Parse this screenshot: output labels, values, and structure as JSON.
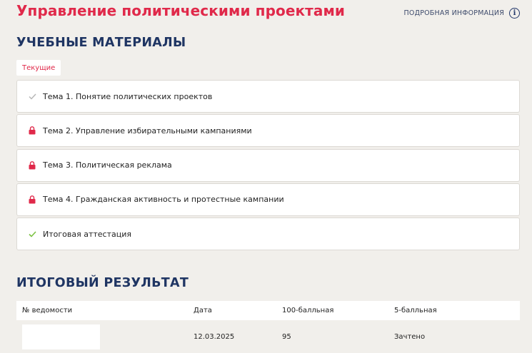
{
  "header": {
    "title": "Управление политическими проектами",
    "info_link": "ПОДРОБНАЯ ИНФОРМАЦИЯ",
    "info_icon": "info-icon"
  },
  "materials": {
    "heading": "УЧЕБНЫЕ МАТЕРИАЛЫ",
    "tab": "Текущие",
    "items": [
      {
        "label": "Тема 1. Понятие политических проектов",
        "status": "completed",
        "icon": "check-icon",
        "icon_color": "#b5b5b5"
      },
      {
        "label": "Тема 2. Управление избирательными кампаниями",
        "status": "locked",
        "icon": "lock-icon",
        "icon_color": "#e0294a"
      },
      {
        "label": "Тема 3. Политическая реклама",
        "status": "locked",
        "icon": "lock-icon",
        "icon_color": "#e0294a"
      },
      {
        "label": "Тема 4. Гражданская активность и протестные кампании",
        "status": "locked",
        "icon": "lock-icon",
        "icon_color": "#e0294a"
      },
      {
        "label": "Итоговая аттестация",
        "status": "completed",
        "icon": "check-icon",
        "icon_color": "#7cc243"
      }
    ]
  },
  "results": {
    "heading": "ИТОГОВЫЙ РЕЗУЛЬТАТ",
    "columns": [
      "№ ведомости",
      "Дата",
      "100-балльная",
      "5-балльная"
    ],
    "rows": [
      {
        "statement_no": "",
        "date": "12.03.2025",
        "score_100": "95",
        "score_5": "Зачтено"
      }
    ]
  },
  "colors": {
    "accent": "#e0294a",
    "heading": "#1f3563",
    "background": "#f1efeb"
  }
}
